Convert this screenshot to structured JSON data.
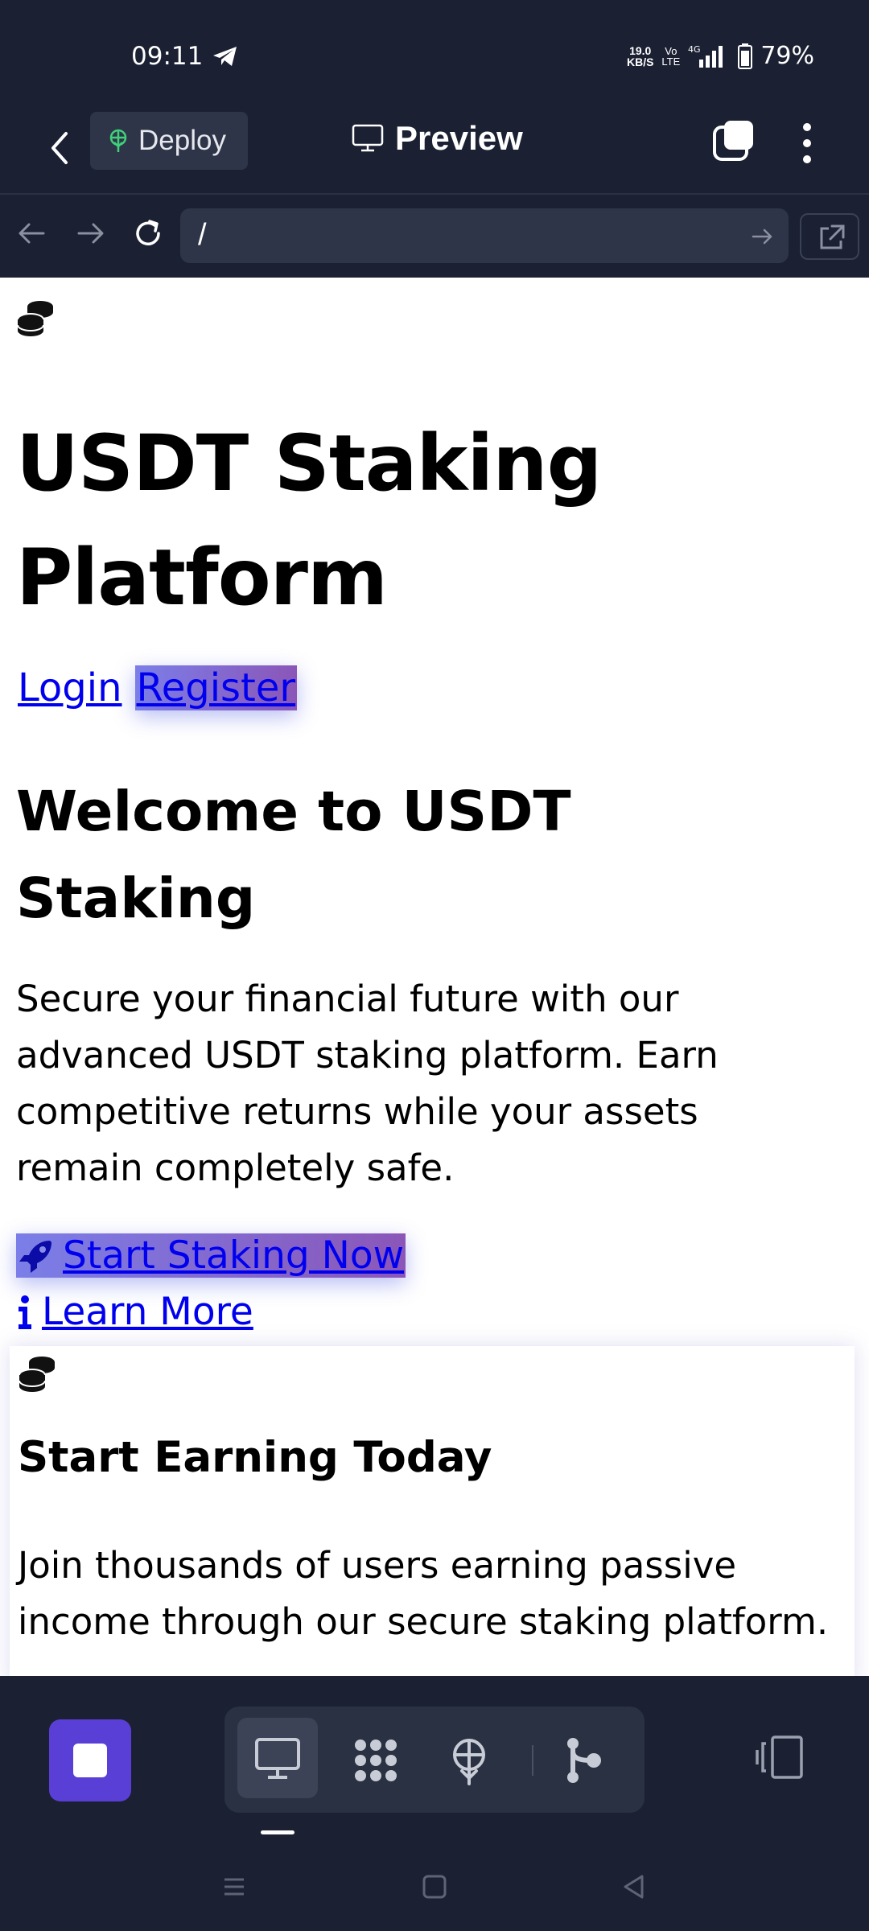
{
  "status_bar": {
    "time": "09:11",
    "net_speed_value": "19.0",
    "net_speed_unit": "KB/S",
    "volte_top": "Vo",
    "volte_bottom": "LTE",
    "network": "4G",
    "battery": "79%"
  },
  "header": {
    "deploy_label": "Deploy",
    "title": "Preview"
  },
  "url_bar": {
    "value": "/"
  },
  "page": {
    "title": "USDT Staking Platform",
    "login_link": "Login",
    "register_link": "Register",
    "welcome_heading": "Welcome to USDT Staking",
    "lead": "Secure your financial future with our advanced USDT staking platform. Earn competitive returns while your assets remain completely safe.",
    "start_cta": "Start Staking Now",
    "learn_cta": "Learn More",
    "card": {
      "title": "Start Earning Today",
      "text": "Join thousands of users earning passive income through our secure staking platform."
    }
  },
  "icons": {
    "coins": "coins-icon",
    "rocket": "rocket-icon",
    "info": "info-icon"
  },
  "colors": {
    "app_bg": "#1b2133",
    "accent": "#5a3fd6",
    "link": "#0000ee",
    "highlight_start": "#7b7ee8",
    "highlight_end": "#8b56b8"
  }
}
